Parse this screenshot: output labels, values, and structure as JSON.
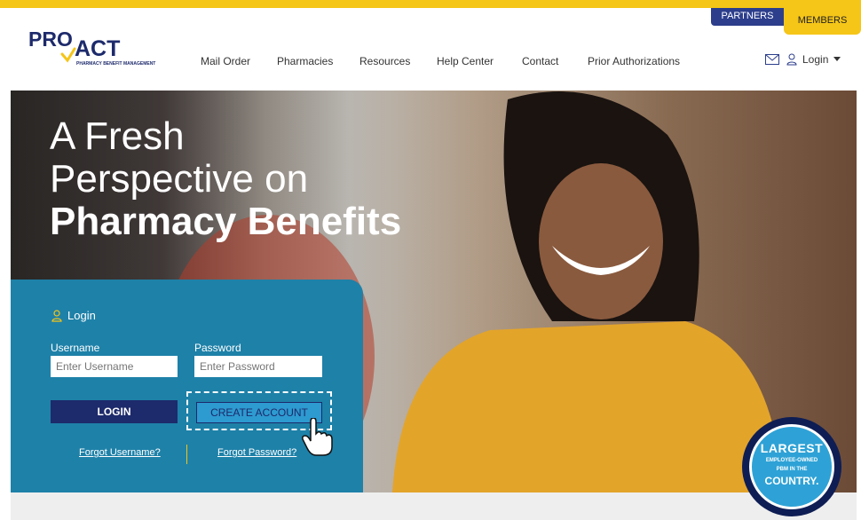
{
  "header": {
    "partners_label": "PARTNERS",
    "members_label": "MEMBERS",
    "logo": {
      "main": "PRO",
      "second": "ACT",
      "tagline": "PHARMACY BENEFIT MANAGEMENT"
    },
    "nav": [
      "Mail Order",
      "Pharmacies",
      "Resources",
      "Help Center",
      "Contact",
      "Prior Authorizations"
    ],
    "login_label": "Login",
    "icons": {
      "mail": "envelope-icon",
      "user": "user-icon",
      "caret": "caret-down-icon"
    }
  },
  "hero": {
    "line1": "A Fresh",
    "line2": "Perspective on",
    "line3": "Pharmacy Benefits"
  },
  "login": {
    "title": "Login",
    "username_label": "Username",
    "username_placeholder": "Enter Username",
    "password_label": "Password",
    "password_placeholder": "Enter Password",
    "login_button": "LOGIN",
    "create_button": "CREATE ACCOUNT",
    "forgot_username": "Forgot Username?",
    "forgot_password": "Forgot Password?"
  },
  "badge": {
    "line1": "LARGEST",
    "line2": "EMPLOYEE-OWNED",
    "line2b": "PBM IN THE",
    "line3": "COUNTRY."
  },
  "colors": {
    "accent_yellow": "#f5c518",
    "navy": "#1d2a6b",
    "login_blue": "#1e81a8"
  }
}
